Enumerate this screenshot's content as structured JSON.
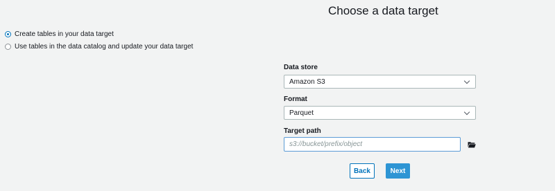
{
  "page": {
    "title": "Choose a data target"
  },
  "target_options": [
    {
      "label": "Create tables in your data target",
      "selected": true
    },
    {
      "label": "Use tables in the data catalog and update your data target",
      "selected": false
    }
  ],
  "form": {
    "data_store": {
      "label": "Data store",
      "value": "Amazon S3"
    },
    "format": {
      "label": "Format",
      "value": "Parquet"
    },
    "target_path": {
      "label": "Target path",
      "value": "",
      "placeholder": "s3://bucket/prefix/object",
      "browse_icon": "folder-icon"
    }
  },
  "buttons": {
    "back": "Back",
    "next": "Next"
  },
  "colors": {
    "background": "#f2f3f3",
    "accent": "#0073bb",
    "primary_button": "#2e95d4",
    "input_focus_border": "#5b9bd5"
  }
}
